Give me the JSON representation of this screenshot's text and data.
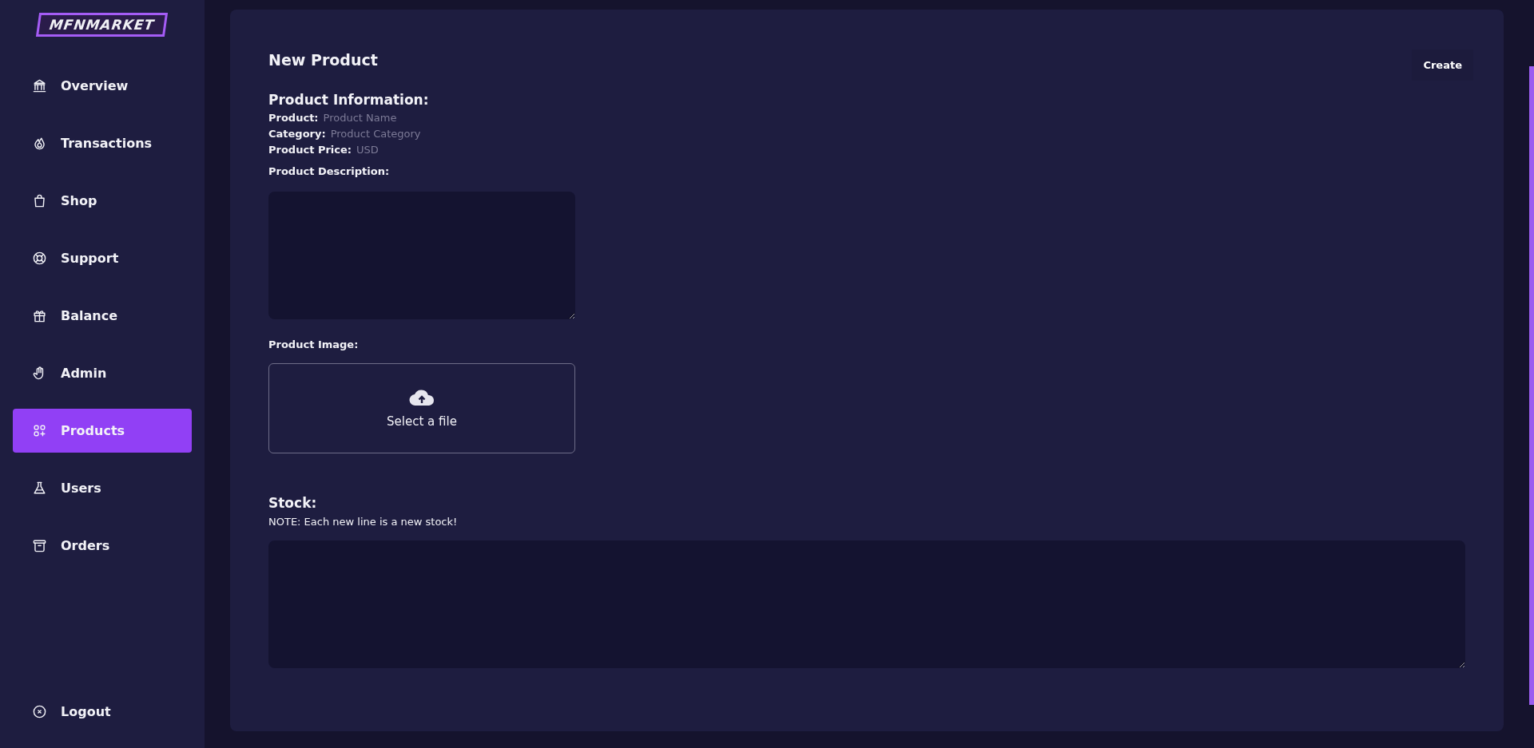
{
  "sidebar": {
    "logo": "MFNMARKET",
    "items": [
      {
        "label": "Overview",
        "selected": false
      },
      {
        "label": "Transactions",
        "selected": false
      },
      {
        "label": "Shop",
        "selected": false
      },
      {
        "label": "Support",
        "selected": false
      },
      {
        "label": "Balance",
        "selected": false
      },
      {
        "label": "Admin",
        "selected": false
      },
      {
        "label": "Products",
        "selected": true
      },
      {
        "label": "Users",
        "selected": false
      },
      {
        "label": "Orders",
        "selected": false
      }
    ],
    "logout": {
      "label": "Logout"
    }
  },
  "page": {
    "title": "New Product",
    "create_button": "Create",
    "info_heading": "Product Information:",
    "fields": [
      {
        "label": "Product:",
        "placeholder": "Product Name"
      },
      {
        "label": "Category:",
        "placeholder": "Product Category"
      },
      {
        "label": "Product Price:",
        "placeholder": "USD"
      }
    ],
    "description_label": "Product Description:",
    "image_label": "Product Image:",
    "upload_text": "Select a file",
    "stock_heading": "Stock:",
    "stock_note": "NOTE: Each new line is a new stock!"
  }
}
